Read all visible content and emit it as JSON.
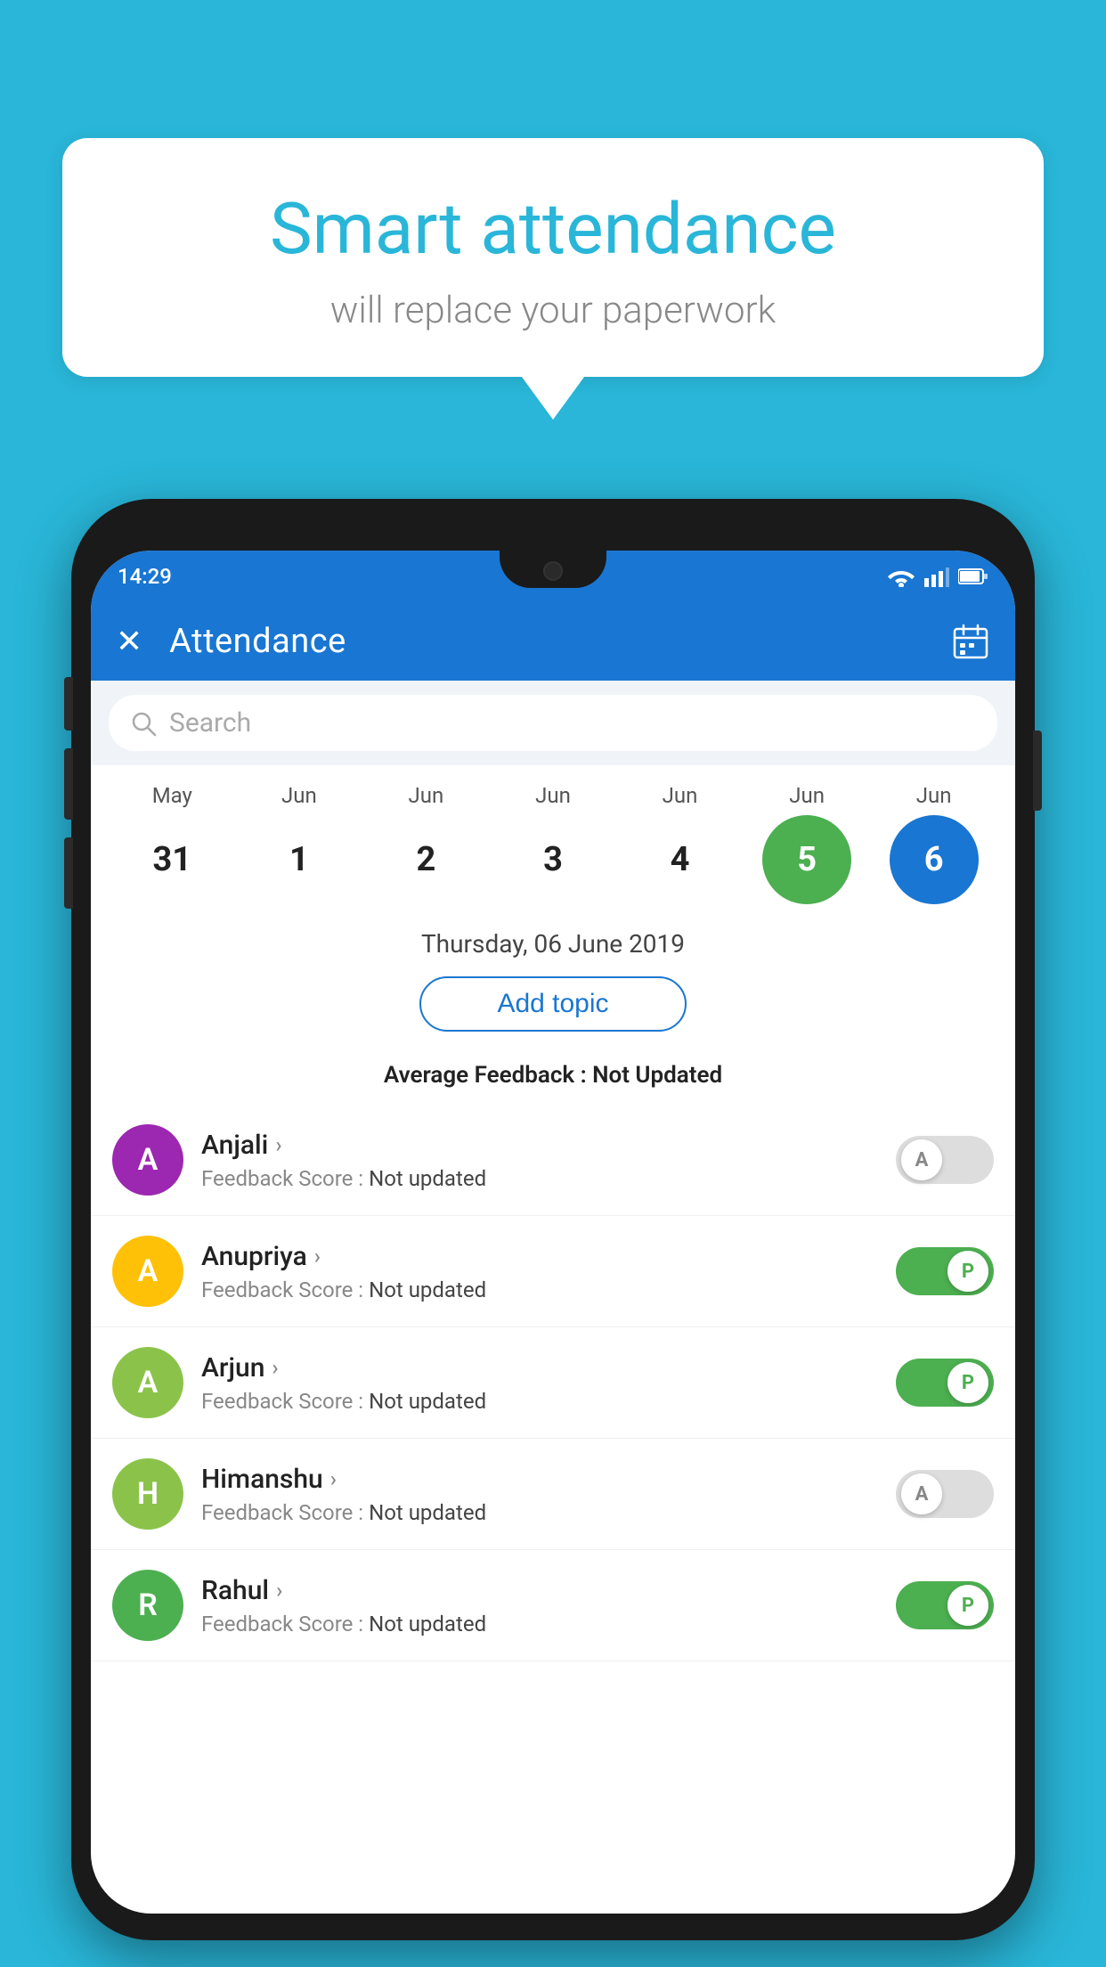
{
  "background_color": "#29B6D8",
  "speech_bubble": {
    "headline": "Smart attendance",
    "subtext": "will replace your paperwork"
  },
  "status_bar": {
    "time": "14:29",
    "icons": [
      "wifi",
      "signal",
      "battery"
    ]
  },
  "app_bar": {
    "title": "Attendance",
    "close_label": "✕",
    "calendar_icon": "📅"
  },
  "search": {
    "placeholder": "Search"
  },
  "calendar": {
    "months": [
      "May",
      "Jun",
      "Jun",
      "Jun",
      "Jun",
      "Jun",
      "Jun"
    ],
    "days": [
      "31",
      "1",
      "2",
      "3",
      "4",
      "5",
      "6"
    ],
    "today_index": 5,
    "selected_index": 6
  },
  "selected_date": "Thursday, 06 June 2019",
  "add_topic_label": "Add topic",
  "average_feedback": {
    "label": "Average Feedback :",
    "value": "Not Updated"
  },
  "students": [
    {
      "name": "Anjali",
      "avatar_letter": "A",
      "avatar_color": "#9C27B0",
      "feedback_label": "Feedback Score :",
      "feedback_value": "Not updated",
      "status": "absent"
    },
    {
      "name": "Anupriya",
      "avatar_letter": "A",
      "avatar_color": "#FFC107",
      "feedback_label": "Feedback Score :",
      "feedback_value": "Not updated",
      "status": "present"
    },
    {
      "name": "Arjun",
      "avatar_letter": "A",
      "avatar_color": "#8BC34A",
      "feedback_label": "Feedback Score :",
      "feedback_value": "Not updated",
      "status": "present"
    },
    {
      "name": "Himanshu",
      "avatar_letter": "H",
      "avatar_color": "#8BC34A",
      "feedback_label": "Feedback Score :",
      "feedback_value": "Not updated",
      "status": "absent"
    },
    {
      "name": "Rahul",
      "avatar_letter": "R",
      "avatar_color": "#4CAF50",
      "feedback_label": "Feedback Score :",
      "feedback_value": "Not updated",
      "status": "present"
    }
  ]
}
